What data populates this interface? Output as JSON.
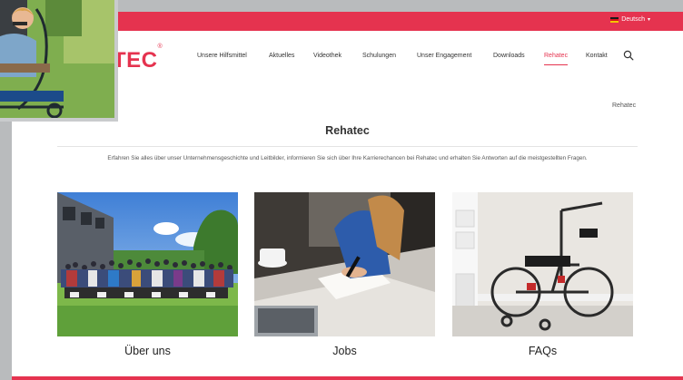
{
  "header": {
    "language": "Deutsch",
    "logo_text": "TEC",
    "logo_mark": "®"
  },
  "nav": {
    "items": [
      "Unsere Hilfsmittel",
      "Aktuelles",
      "Videothek",
      "Schulungen",
      "Unser Engagement",
      "Downloads",
      "Rehatec",
      "Kontakt"
    ],
    "active": "Rehatec"
  },
  "breadcrumb": "Rehatec",
  "page": {
    "title": "Rehatec",
    "intro": "Erfahren Sie alles über unser Unternehmensgeschichte und Leitbilder, informieren Sie sich über Ihre Karrierechancen bei Rehatec und erhalten Sie Antworten auf die meistgestellten Fragen."
  },
  "cards": [
    {
      "label": "Über uns"
    },
    {
      "label": "Jobs"
    },
    {
      "label": "FAQs"
    }
  ],
  "colors": {
    "brand": "#e5334f"
  }
}
